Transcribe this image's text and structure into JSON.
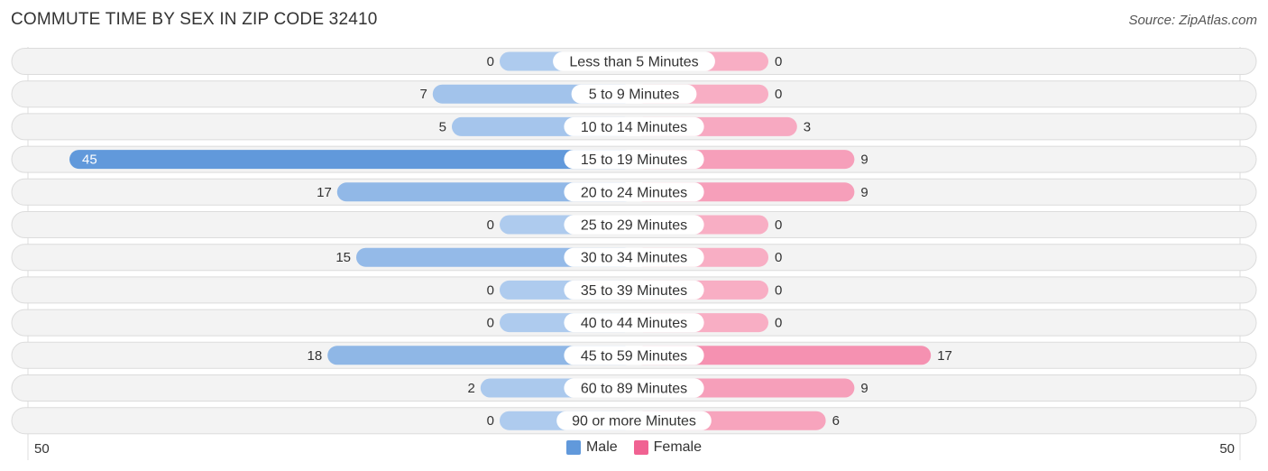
{
  "chart_data": {
    "type": "bar",
    "orientation": "horizontal-diverging",
    "title": "COMMUTE TIME BY SEX IN ZIP CODE 32410",
    "source": "Source: ZipAtlas.com",
    "categories": [
      "Less than 5 Minutes",
      "5 to 9 Minutes",
      "10 to 14 Minutes",
      "15 to 19 Minutes",
      "20 to 24 Minutes",
      "25 to 29 Minutes",
      "30 to 34 Minutes",
      "35 to 39 Minutes",
      "40 to 44 Minutes",
      "45 to 59 Minutes",
      "60 to 89 Minutes",
      "90 or more Minutes"
    ],
    "series": [
      {
        "name": "Male",
        "color": "#6199db",
        "values": [
          0,
          7,
          5,
          45,
          17,
          0,
          15,
          0,
          0,
          18,
          2,
          0
        ]
      },
      {
        "name": "Female",
        "color": "#f06292",
        "values": [
          0,
          0,
          3,
          9,
          9,
          0,
          0,
          0,
          0,
          17,
          9,
          6
        ]
      }
    ],
    "axis": {
      "left_label": "50",
      "right_label": "50",
      "range": [
        0,
        50
      ]
    },
    "legend": {
      "position": "bottom-center",
      "entries": [
        "Male",
        "Female"
      ]
    }
  }
}
